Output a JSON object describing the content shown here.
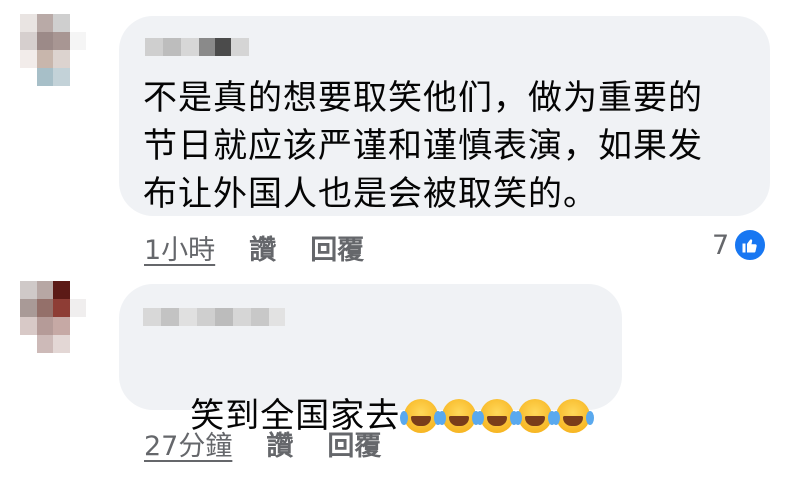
{
  "comments": [
    {
      "text": "不是真的想要取笑他们，做为重要的\n节日就应该严谨和谨慎表演，如果发\n布让外国人也是会被取笑的。",
      "time": "1小時",
      "like_label": "讚",
      "reply_label": "回覆",
      "reaction_count": "7",
      "reaction_icon": "like-icon",
      "avatar_blurred": true,
      "name_blurred": true
    },
    {
      "text": "笑到全国家去",
      "emojis": [
        "face-with-tears-of-joy-icon",
        "face-with-tears-of-joy-icon",
        "face-with-tears-of-joy-icon",
        "face-with-tears-of-joy-icon",
        "face-with-tears-of-joy-icon"
      ],
      "time": "27分鐘",
      "like_label": "讚",
      "reply_label": "回覆",
      "avatar_blurred": true,
      "name_blurred": true
    }
  ],
  "colors": {
    "bubble": "#f0f2f5",
    "text": "#050505",
    "meta": "#65676b",
    "like_blue": "#1877f2"
  }
}
